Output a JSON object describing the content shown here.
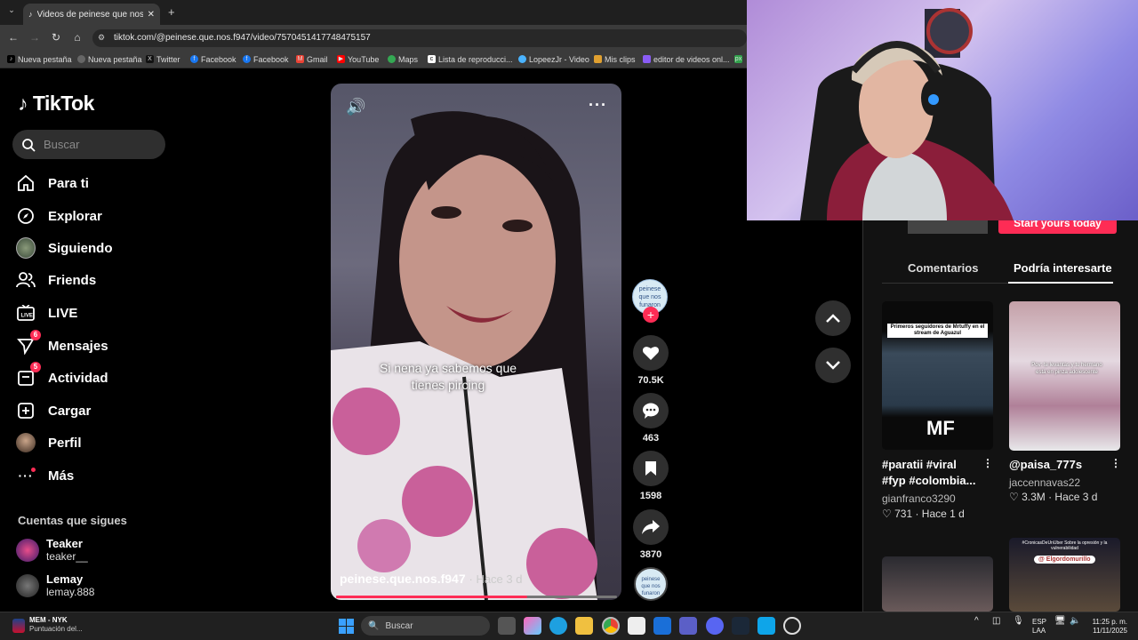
{
  "browser": {
    "tab_title": "Videos de peinese que nos fun...",
    "url": "tiktok.com/@peinese.que.nos.f947/video/7570451417748475157",
    "bookmarks": [
      "Nueva pestaña",
      "Nueva pestaña",
      "Twitter",
      "Facebook",
      "Facebook",
      "Gmail",
      "YouTube",
      "Maps",
      "Lista de reproducci...",
      "LopeezJr - Video",
      "Mis clips",
      "editor de videos onl..."
    ]
  },
  "sidebar": {
    "logo": "TikTok",
    "search_placeholder": "Buscar",
    "items": [
      {
        "label": "Para ti",
        "icon": "home-icon"
      },
      {
        "label": "Explorar",
        "icon": "compass-icon"
      },
      {
        "label": "Siguiendo",
        "icon": "following-avatar"
      },
      {
        "label": "Friends",
        "icon": "friends-icon"
      },
      {
        "label": "LIVE",
        "icon": "live-icon"
      },
      {
        "label": "Mensajes",
        "icon": "send-icon",
        "badge": "6"
      },
      {
        "label": "Actividad",
        "icon": "inbox-icon",
        "badge": "5"
      },
      {
        "label": "Cargar",
        "icon": "upload-icon"
      },
      {
        "label": "Perfil",
        "icon": "profile-avatar"
      },
      {
        "label": "Más",
        "icon": "more-icon"
      }
    ],
    "following_title": "Cuentas que sigues",
    "accounts": [
      {
        "name": "Teaker",
        "user": "teaker__"
      },
      {
        "name": "Lemay",
        "user": "lemay.888"
      }
    ]
  },
  "video": {
    "caption_line1": "Si nena ya sabemos que",
    "caption_line2": "tienes pircing",
    "author": "peinese.que.nos.f947",
    "time": "· Hace 3 d",
    "progress": 0.68,
    "likes": "70.5K",
    "comments": "463",
    "saves": "1598",
    "shares": "3870"
  },
  "right_panel": {
    "start_button": "Start yours today",
    "tab_comments": "Comentarios",
    "tab_suggested": "Podría interesarte",
    "cards": [
      {
        "title_line1": "#paratii #viral",
        "title_line2": "#fyp #colombia...",
        "user": "gianfranco3290",
        "stats": "♡ 731 · Hace 1 d",
        "thumb_text": "Primeros seguidores de Mrtuffy en el stream de Aguazul"
      },
      {
        "title_line1": "@paisa_777s",
        "title_line2": "",
        "user": "jaccennavas22",
        "stats": "♡ 3.3M · Hace 3 d",
        "thumb_text": "Pov: te levantas y tu hermano está en pinza adolescente"
      },
      {
        "thumb_text": ""
      },
      {
        "thumb_text": "#CronicasDeUnUber Sobre la opresión y la vulnerabilidad",
        "tag": "@ Elgordomurillo"
      }
    ]
  },
  "taskbar": {
    "app_title": "MEM - NYK",
    "app_sub": "Puntuación del...",
    "search": "Buscar",
    "lang1": "ESP",
    "lang2": "LAA",
    "time": "11:25 p. m.",
    "date": "11/11/2025"
  }
}
